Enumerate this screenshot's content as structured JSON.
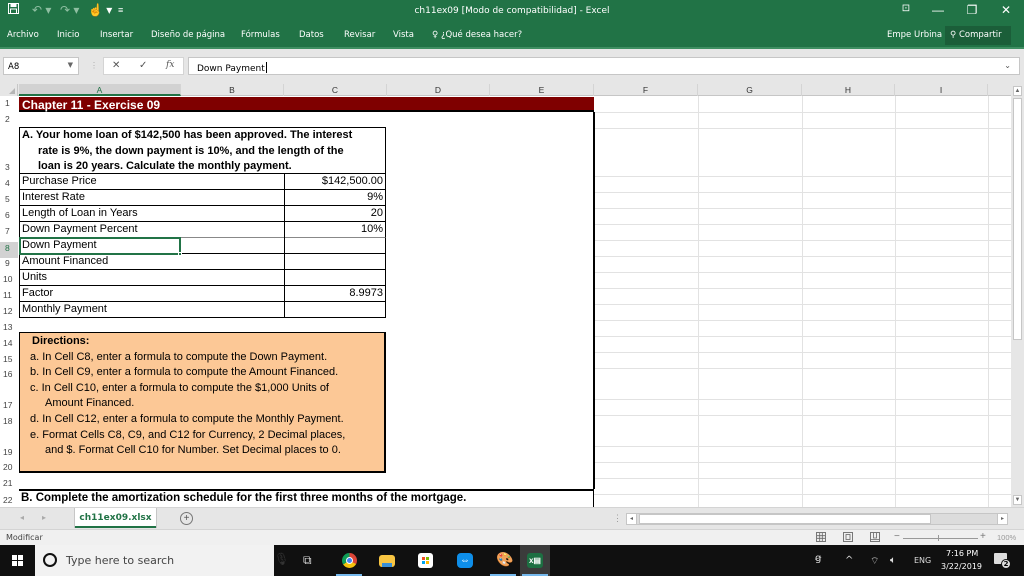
{
  "window": {
    "title": "ch11ex09  [Modo de compatibilidad] - Excel",
    "controls": {
      "ribbon_display": "⊡",
      "minimize": "—",
      "restore": "❐",
      "close": "✕"
    }
  },
  "quick_access": {
    "save_icon": "save-icon",
    "undo_icon": "undo-icon",
    "redo_icon": "redo-icon",
    "touch_icon": "touch-mode-icon",
    "customize_icon": "customize-qat-icon"
  },
  "ribbon": {
    "tabs": [
      {
        "label": "Archivo"
      },
      {
        "label": "Inicio"
      },
      {
        "label": "Insertar"
      },
      {
        "label": "Diseño de página"
      },
      {
        "label": "Fórmulas"
      },
      {
        "label": "Datos"
      },
      {
        "label": "Revisar"
      },
      {
        "label": "Vista"
      }
    ],
    "tell_me": "¿Qué desea hacer?",
    "user": "Empe Urbina",
    "share": "Compartir"
  },
  "formula_bar": {
    "name_box": "A8",
    "cancel": "✕",
    "enter": "✓",
    "fx": "fx",
    "value": "Down Payment"
  },
  "columns": [
    "A",
    "B",
    "C",
    "D",
    "E",
    "F",
    "G",
    "H",
    "I"
  ],
  "rows": [
    "1",
    "2",
    "3",
    "4",
    "5",
    "6",
    "7",
    "8",
    "9",
    "10",
    "11",
    "12",
    "13",
    "14",
    "15",
    "16",
    "17",
    "18",
    "19",
    "20",
    "21",
    "22"
  ],
  "sheet": {
    "title": "Chapter 11 - Exercise 09",
    "problem_a": [
      "A.  Your home loan of $142,500 has been approved. The interest",
      "rate is 9%, the down payment is 10%, and the length of the",
      "loan is 20 years. Calculate the monthly payment."
    ],
    "inputs": [
      {
        "label": "Purchase Price",
        "value": "$142,500.00"
      },
      {
        "label": "Interest Rate",
        "value": "9%"
      },
      {
        "label": "Length of Loan in Years",
        "value": "20"
      },
      {
        "label": "Down Payment Percent",
        "value": "10%"
      },
      {
        "label": "Down Payment",
        "value": ""
      },
      {
        "label": "Amount Financed",
        "value": ""
      },
      {
        "label": "Units",
        "value": ""
      },
      {
        "label": "Factor",
        "value": "8.9973"
      },
      {
        "label": "Monthly Payment",
        "value": ""
      }
    ],
    "directions": {
      "title": "Directions:",
      "lines": [
        {
          "text": "a.  In Cell C8, enter a formula to compute the Down Payment.",
          "indent": false
        },
        {
          "text": "b.  In Cell C9, enter a formula to compute the Amount Financed.",
          "indent": false
        },
        {
          "text": "c.  In Cell C10, enter a formula to compute the $1,000 Units of",
          "indent": false
        },
        {
          "text": "Amount Financed.",
          "indent": true
        },
        {
          "text": "d.  In Cell C12, enter a formula to compute the Monthly Payment.",
          "indent": false
        },
        {
          "text": "e.  Format Cells C8, C9, and C12 for Currency, 2 Decimal places,",
          "indent": false
        },
        {
          "text": "and $. Format Cell C10 for Number. Set Decimal places to 0.",
          "indent": true
        }
      ]
    },
    "problem_b": "B.  Complete the amortization schedule for the first three months of the mortgage."
  },
  "sheet_tabs": {
    "active": "ch11ex09.xlsx",
    "add": "+"
  },
  "status_bar": {
    "mode": "Modificar",
    "zoom": "100%",
    "zoom_minus": "−",
    "zoom_plus": "+"
  },
  "taskbar": {
    "search_placeholder": "Type here to search",
    "apps": [
      {
        "name": "task-view"
      },
      {
        "name": "chrome"
      },
      {
        "name": "file-explorer"
      },
      {
        "name": "microsoft-store"
      },
      {
        "name": "teamviewer"
      },
      {
        "name": "paint"
      },
      {
        "name": "excel"
      }
    ],
    "language": "ENG",
    "time": "7:16 PM",
    "date": "3/22/2019",
    "notifications": "2"
  },
  "colors": {
    "excel_green": "#217346",
    "title_band": "#7f0000",
    "directions_fill": "#fcc896"
  }
}
